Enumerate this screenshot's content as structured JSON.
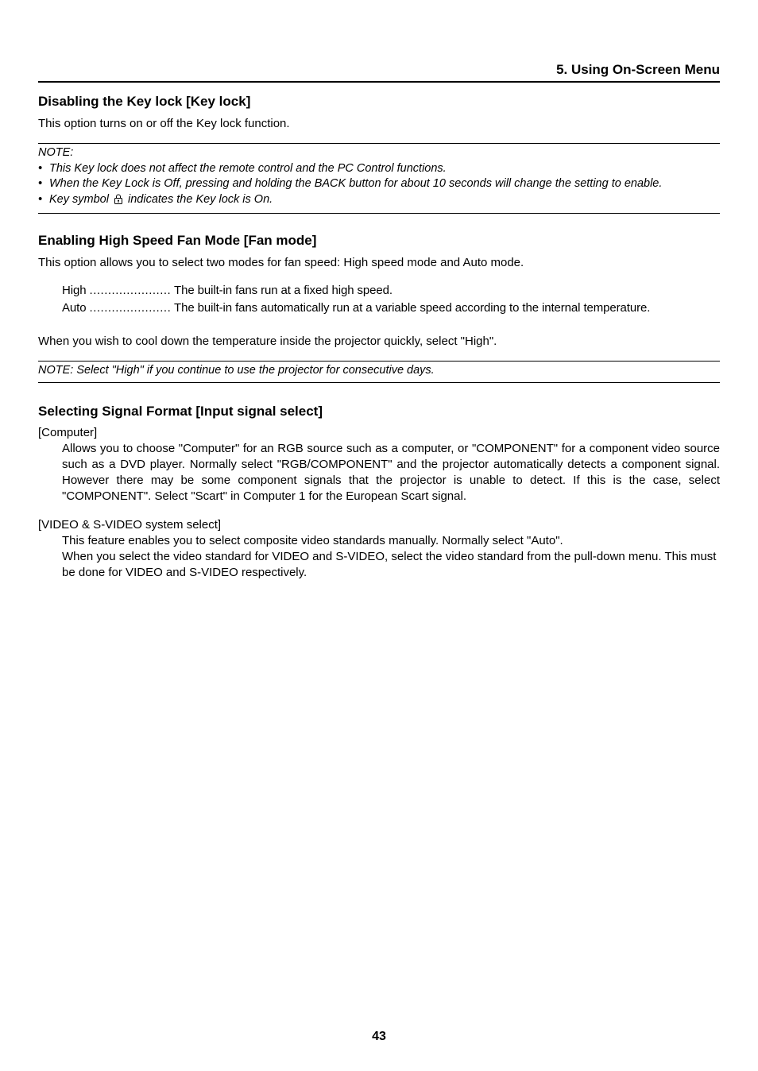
{
  "header": {
    "section_title": "5. Using On-Screen Menu"
  },
  "sections": {
    "keylock": {
      "title": "Disabling the Key lock [Key lock]",
      "intro": "This option turns on or off the Key lock function.",
      "note_label": "NOTE:",
      "notes": [
        "This Key lock does not affect the remote control and the PC Control functions.",
        "When the Key Lock is Off, pressing and holding the BACK button for about 10 seconds will change the setting to enable."
      ],
      "note3_prefix": "Key symbol",
      "note3_suffix": " indicates the Key lock is On."
    },
    "fanmode": {
      "title": "Enabling High Speed Fan Mode [Fan mode]",
      "intro": "This option allows you to select two modes for fan speed: High speed mode and Auto mode.",
      "items": {
        "high_label": "High",
        "high_dots": "......................",
        "high_desc": "The built-in fans run at a fixed high speed.",
        "auto_label": "Auto",
        "auto_dots": "......................",
        "auto_desc": "The built-in fans automatically run at a variable speed according to the internal temperature."
      },
      "body2": "When you wish to cool down the temperature inside the projector quickly, select \"High\".",
      "note": "NOTE: Select \"High\" if you continue to use the projector for consecutive days."
    },
    "signalformat": {
      "title": "Selecting Signal Format [Input signal select]",
      "computer_head": "[Computer]",
      "computer_body": "Allows you to choose \"Computer\" for an RGB source such as a computer, or \"COMPONENT\" for a component video source such as a DVD player. Normally select \"RGB/COMPONENT\" and the projector automatically detects a component signal. However there may be some component signals that the projector is unable to detect. If this is the case, select \"COMPONENT\". Select \"Scart\" in Computer 1 for the European Scart signal.",
      "video_head": "[VIDEO & S-VIDEO system select]",
      "video_body": "This feature enables you to select composite video standards manually. Normally select \"Auto\".\nWhen you select the video standard for VIDEO and S-VIDEO, select the video standard from the pull-down menu. This must be done for VIDEO and S-VIDEO respectively."
    }
  },
  "page_number": "43"
}
